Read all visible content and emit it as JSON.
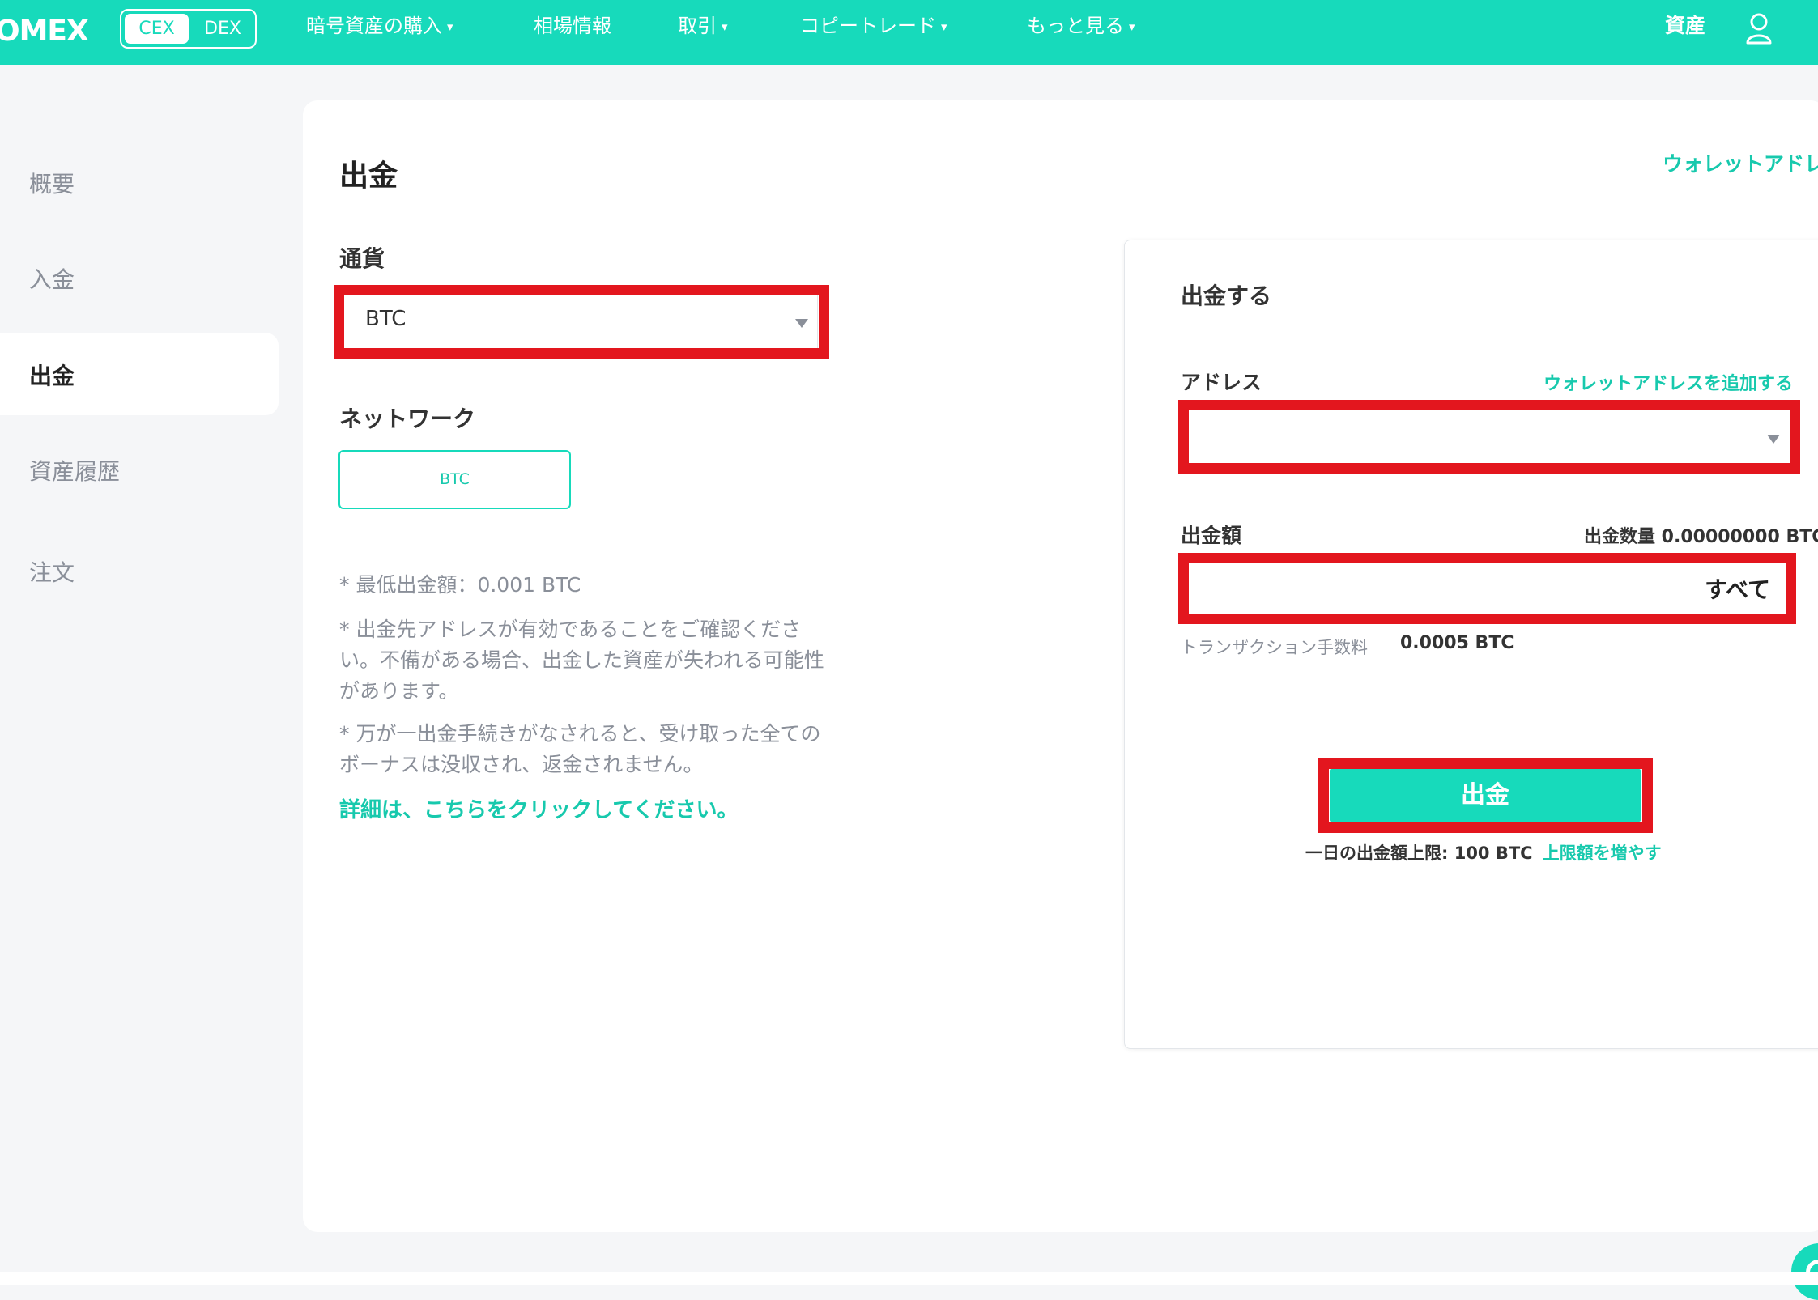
{
  "header": {
    "brand": "OMEX",
    "mode_tabs": {
      "cex": "CEX",
      "dex": "DEX"
    },
    "nav": [
      {
        "label": "暗号資産の購入",
        "dropdown": true
      },
      {
        "label": "相場情報",
        "dropdown": false
      },
      {
        "label": "取引",
        "dropdown": true
      },
      {
        "label": "コピートレード",
        "dropdown": true
      },
      {
        "label": "もっと見る",
        "dropdown": true
      }
    ],
    "caret": "▾",
    "assets": "資産",
    "user_icon": "user-icon"
  },
  "sidebar": {
    "items": [
      {
        "label": "概要",
        "active": false
      },
      {
        "label": "入金",
        "active": false
      },
      {
        "label": "出金",
        "active": true
      },
      {
        "label": "資産履歴",
        "active": false
      },
      {
        "label": "注文",
        "active": false
      }
    ]
  },
  "main": {
    "title": "出金",
    "wallet_link": "ウォレットアドレ",
    "currency_label": "通貨",
    "currency_value": "BTC",
    "network_label": "ネットワーク",
    "network_option": "BTC",
    "notes": [
      "* 最低出金額：0.001 BTC",
      "* 出金先アドレスが有効であることをご確認ください。不備がある場合、出金した資産が失われる可能性があります。",
      "* 万が一出金手続きがなされると、受け取った全てのボーナスは没収され、返金されません。"
    ],
    "details_link": "詳細は、こちらをクリックしてください。"
  },
  "withdraw_panel": {
    "title": "出金する",
    "address_label": "アドレス",
    "add_wallet_link": "ウォレットアドレスを追加する",
    "address_value": "",
    "amount_label": "出金額",
    "amount_available": "出金数量 0.00000000 BTC",
    "amount_value": "",
    "all_button": "すべて",
    "fee_label": "トランザクション手数料",
    "fee_value": "0.0005 BTC",
    "submit_button": "出金",
    "daily_limit": "一日の出金額上限: 100 BTC",
    "increase_limit_link": "上限額を増やす"
  },
  "colors": {
    "brand": "#17dabb",
    "highlight": "#e3161e",
    "background": "#f5f6f8"
  }
}
